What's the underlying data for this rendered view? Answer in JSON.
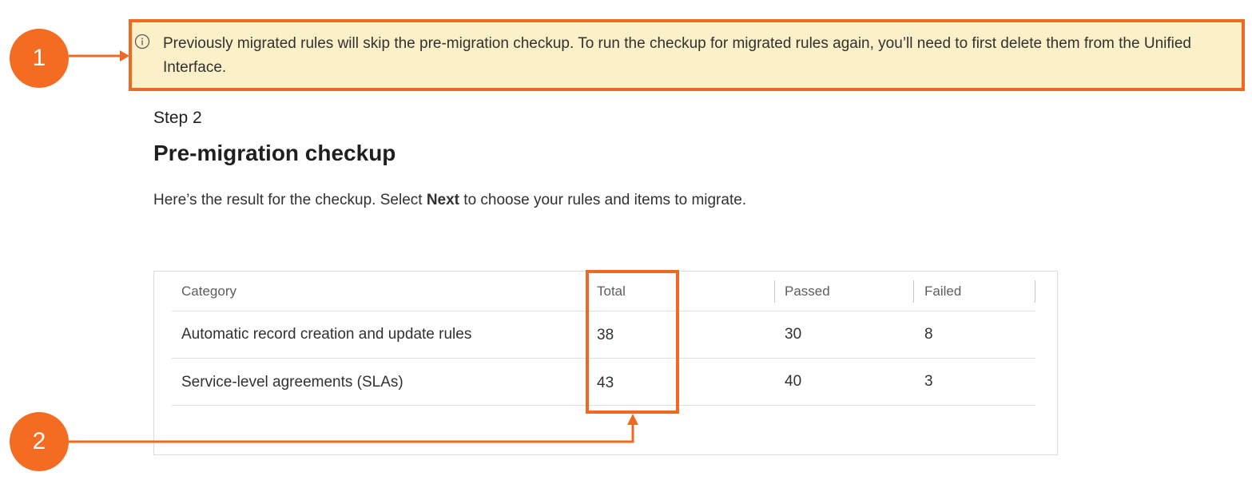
{
  "notice": {
    "icon": "info-icon",
    "text": "Previously migrated rules will skip the pre-migration checkup. To run the checkup for migrated rules again, you’ll need to first delete them from the Unified Interface."
  },
  "step": {
    "label": "Step 2",
    "title": "Pre-migration checkup",
    "description_before": "Here’s the result for the checkup. Select ",
    "description_bold": "Next",
    "description_after": " to choose your rules and items to migrate."
  },
  "table": {
    "headers": {
      "category": "Category",
      "total": "Total",
      "passed": "Passed",
      "failed": "Failed"
    },
    "rows": [
      {
        "category": "Automatic record creation and update rules",
        "total": "38",
        "passed": "30",
        "failed": "8"
      },
      {
        "category": "Service-level agreements (SLAs)",
        "total": "43",
        "passed": "40",
        "failed": "3"
      }
    ]
  },
  "callouts": {
    "one": "1",
    "two": "2"
  },
  "colors": {
    "accent": "#ee6a22",
    "notice_bg": "#fbf0c8"
  }
}
